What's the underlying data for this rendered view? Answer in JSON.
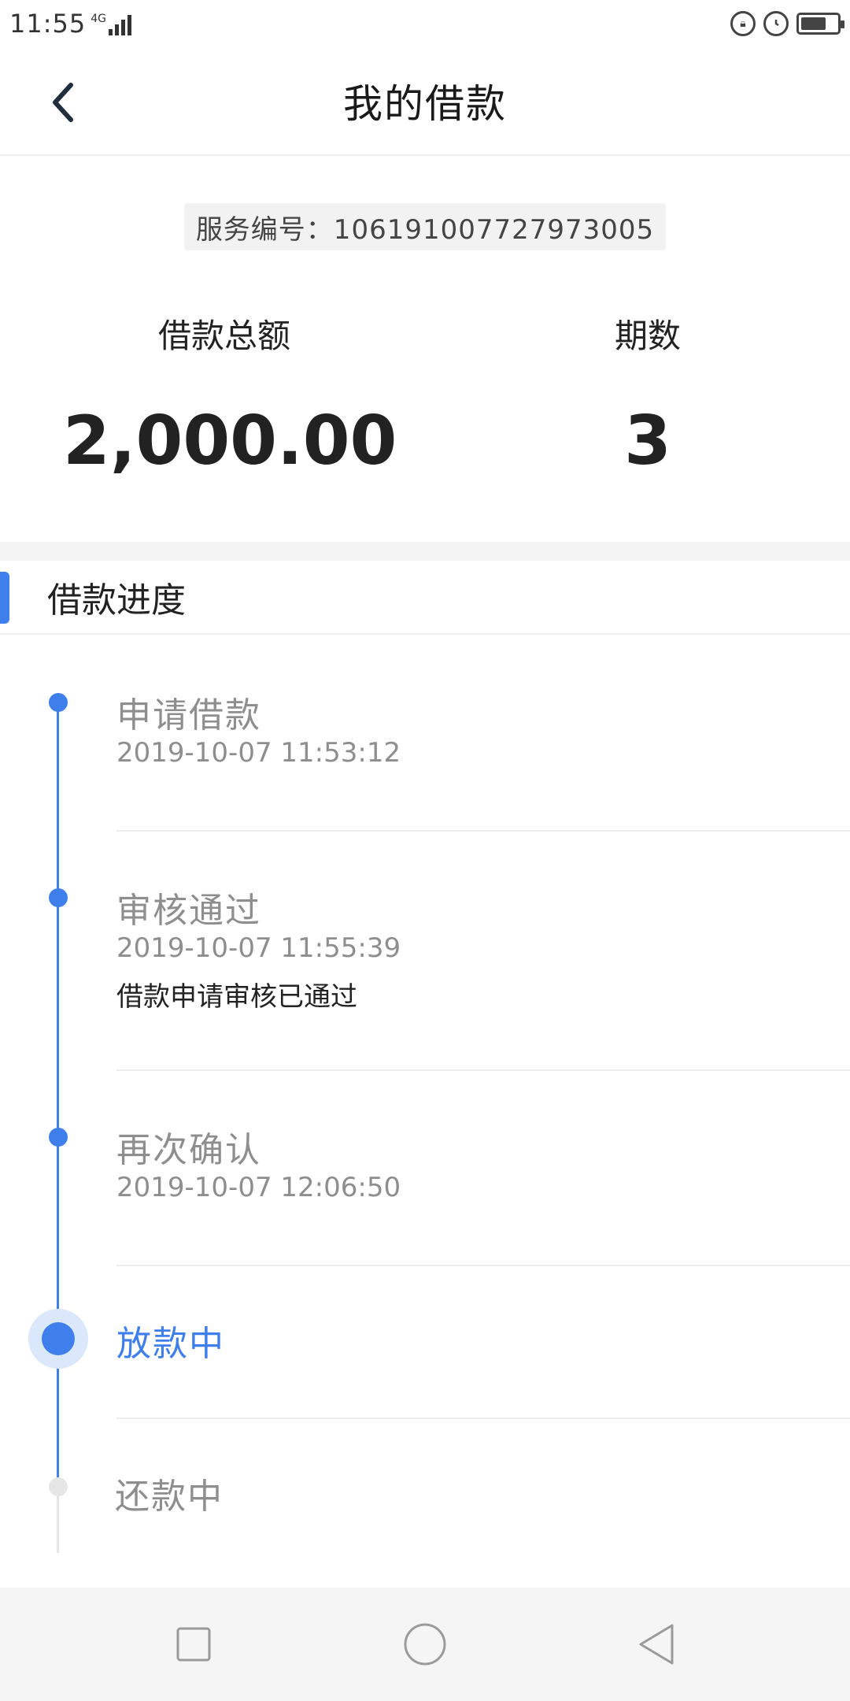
{
  "status_bar": {
    "time": "11:55",
    "network": "4G",
    "icons": [
      "lock-rotation-icon",
      "alarm-icon",
      "battery-icon"
    ],
    "battery_level": 0.7
  },
  "header": {
    "title": "我的借款",
    "back_icon": "chevron-left-icon"
  },
  "summary": {
    "service_no": "服务编号：106191007727973005",
    "total_label": "借款总额",
    "total_value": "2,000.00",
    "periods_label": "期数",
    "periods_value": "3"
  },
  "progress": {
    "title": "借款进度",
    "accent_color": "#3f7fec",
    "steps": [
      {
        "title": "申请借款",
        "time": "2019-10-07 11:53:12",
        "status": "done"
      },
      {
        "title": "审核通过",
        "time": "2019-10-07 11:55:39",
        "note": "借款申请审核已通过",
        "status": "done"
      },
      {
        "title": "再次确认",
        "time": "2019-10-07 12:06:50",
        "status": "done"
      },
      {
        "title": "放款中",
        "status": "current"
      },
      {
        "title": "还款中",
        "status": "pending"
      }
    ]
  },
  "nav_bar": {
    "buttons": [
      "recent-apps-icon",
      "home-icon",
      "back-triangle-icon"
    ]
  }
}
